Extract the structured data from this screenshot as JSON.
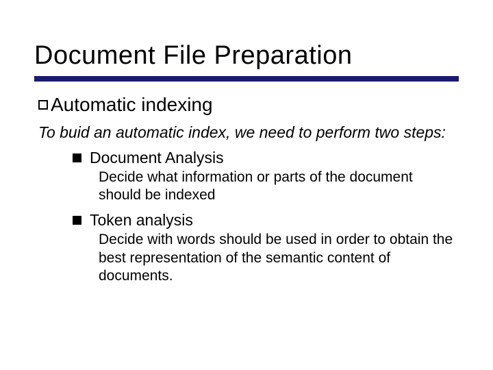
{
  "title": "Document File Preparation",
  "subtitle": "Automatic indexing",
  "intro": "To buid an automatic index, we need to perform two steps:",
  "items": [
    {
      "title": "Document Analysis",
      "desc": "Decide what information or parts of the document should be indexed"
    },
    {
      "title": "Token analysis",
      "desc": "Decide with words should be used in order to obtain the best representation of the semantic content of documents."
    }
  ]
}
